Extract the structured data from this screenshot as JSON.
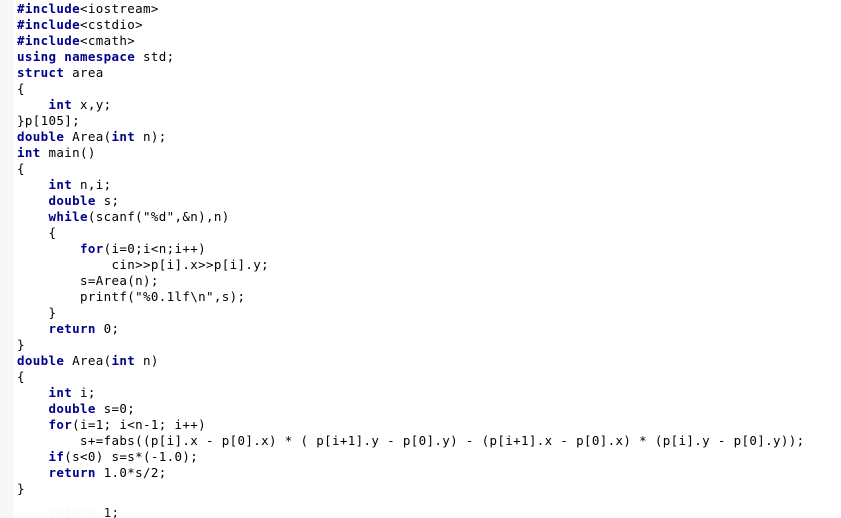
{
  "editor": {
    "language": "C++",
    "gutter_color": "#f7f7f8",
    "background_color": "#ffffff",
    "keyword_color": "#00008b",
    "text_color": "#000000",
    "font_size_px": 12.5,
    "line_height_px": 16
  },
  "code": {
    "lines": [
      {
        "indent": 0,
        "tokens": [
          {
            "t": "kw",
            "v": "#include"
          },
          {
            "t": "pln",
            "v": "<iostream>"
          }
        ]
      },
      {
        "indent": 0,
        "tokens": [
          {
            "t": "kw",
            "v": "#include"
          },
          {
            "t": "pln",
            "v": "<cstdio>"
          }
        ]
      },
      {
        "indent": 0,
        "tokens": [
          {
            "t": "kw",
            "v": "#include"
          },
          {
            "t": "pln",
            "v": "<cmath>"
          }
        ]
      },
      {
        "indent": 0,
        "tokens": [
          {
            "t": "kw",
            "v": "using namespace"
          },
          {
            "t": "pln",
            "v": " std;"
          }
        ]
      },
      {
        "indent": 0,
        "tokens": [
          {
            "t": "kw",
            "v": "struct"
          },
          {
            "t": "pln",
            "v": " area"
          }
        ]
      },
      {
        "indent": 0,
        "tokens": [
          {
            "t": "pln",
            "v": "{"
          }
        ]
      },
      {
        "indent": 0,
        "tokens": [
          {
            "t": "pln",
            "v": "    "
          },
          {
            "t": "kw",
            "v": "int"
          },
          {
            "t": "pln",
            "v": " x,y;"
          }
        ]
      },
      {
        "indent": 0,
        "tokens": [
          {
            "t": "pln",
            "v": "}p[105];"
          }
        ]
      },
      {
        "indent": 0,
        "tokens": [
          {
            "t": "kw",
            "v": "double"
          },
          {
            "t": "pln",
            "v": " Area("
          },
          {
            "t": "kw",
            "v": "int"
          },
          {
            "t": "pln",
            "v": " n);"
          }
        ]
      },
      {
        "indent": 0,
        "tokens": [
          {
            "t": "kw",
            "v": "int"
          },
          {
            "t": "pln",
            "v": " main()"
          }
        ]
      },
      {
        "indent": 0,
        "tokens": [
          {
            "t": "pln",
            "v": "{"
          }
        ]
      },
      {
        "indent": 0,
        "tokens": [
          {
            "t": "pln",
            "v": "    "
          },
          {
            "t": "kw",
            "v": "int"
          },
          {
            "t": "pln",
            "v": " n,i;"
          }
        ]
      },
      {
        "indent": 0,
        "tokens": [
          {
            "t": "pln",
            "v": "    "
          },
          {
            "t": "kw",
            "v": "double"
          },
          {
            "t": "pln",
            "v": " s;"
          }
        ]
      },
      {
        "indent": 0,
        "tokens": [
          {
            "t": "pln",
            "v": "    "
          },
          {
            "t": "kw",
            "v": "while"
          },
          {
            "t": "pln",
            "v": "(scanf(\"%d\",&n),n)"
          }
        ]
      },
      {
        "indent": 0,
        "tokens": [
          {
            "t": "pln",
            "v": "    {"
          }
        ]
      },
      {
        "indent": 0,
        "tokens": [
          {
            "t": "pln",
            "v": "        "
          },
          {
            "t": "kw",
            "v": "for"
          },
          {
            "t": "pln",
            "v": "(i=0;i<n;i++)"
          }
        ]
      },
      {
        "indent": 0,
        "tokens": [
          {
            "t": "pln",
            "v": "            cin>>p[i].x>>p[i].y;"
          }
        ]
      },
      {
        "indent": 0,
        "tokens": [
          {
            "t": "pln",
            "v": "        s=Area(n);"
          }
        ]
      },
      {
        "indent": 0,
        "tokens": [
          {
            "t": "pln",
            "v": "        printf(\"%0.1lf\\n\",s);"
          }
        ]
      },
      {
        "indent": 0,
        "tokens": [
          {
            "t": "pln",
            "v": "    }"
          }
        ]
      },
      {
        "indent": 0,
        "tokens": [
          {
            "t": "pln",
            "v": "    "
          },
          {
            "t": "kw",
            "v": "return"
          },
          {
            "t": "pln",
            "v": " 0;"
          }
        ]
      },
      {
        "indent": 0,
        "tokens": [
          {
            "t": "pln",
            "v": "}"
          }
        ]
      },
      {
        "indent": 0,
        "tokens": [
          {
            "t": "kw",
            "v": "double"
          },
          {
            "t": "pln",
            "v": " Area("
          },
          {
            "t": "kw",
            "v": "int"
          },
          {
            "t": "pln",
            "v": " n)"
          }
        ]
      },
      {
        "indent": 0,
        "tokens": [
          {
            "t": "pln",
            "v": "{"
          }
        ]
      },
      {
        "indent": 0,
        "tokens": [
          {
            "t": "pln",
            "v": "    "
          },
          {
            "t": "kw",
            "v": "int"
          },
          {
            "t": "pln",
            "v": " i;"
          }
        ]
      },
      {
        "indent": 0,
        "tokens": [
          {
            "t": "pln",
            "v": "    "
          },
          {
            "t": "kw",
            "v": "double"
          },
          {
            "t": "pln",
            "v": " s=0;"
          }
        ]
      },
      {
        "indent": 0,
        "tokens": [
          {
            "t": "pln",
            "v": "    "
          },
          {
            "t": "kw",
            "v": "for"
          },
          {
            "t": "pln",
            "v": "(i=1; i<n-1; i++)"
          }
        ]
      },
      {
        "indent": 0,
        "tokens": [
          {
            "t": "pln",
            "v": "        s+=fabs((p[i].x - p[0].x) * ( p[i+1].y - p[0].y) - (p[i+1].x - p[0].x) * (p[i].y - p[0].y));"
          }
        ]
      },
      {
        "indent": 0,
        "tokens": [
          {
            "t": "pln",
            "v": "    "
          },
          {
            "t": "kw",
            "v": "if"
          },
          {
            "t": "pln",
            "v": "(s<0) s=s*(-1.0);"
          }
        ]
      },
      {
        "indent": 0,
        "tokens": [
          {
            "t": "pln",
            "v": "    "
          },
          {
            "t": "kw",
            "v": "return"
          },
          {
            "t": "pln",
            "v": " 1.0*s/2;"
          }
        ]
      },
      {
        "indent": 0,
        "tokens": [
          {
            "t": "pln",
            "v": "}"
          }
        ]
      }
    ],
    "remnant_lines": [
      {
        "indent": 0,
        "tokens": [
          {
            "t": "pln",
            "v": "    "
          },
          {
            "t": "kw",
            "v": "return"
          },
          {
            "t": "pln",
            "v": " 1;"
          }
        ]
      }
    ]
  }
}
